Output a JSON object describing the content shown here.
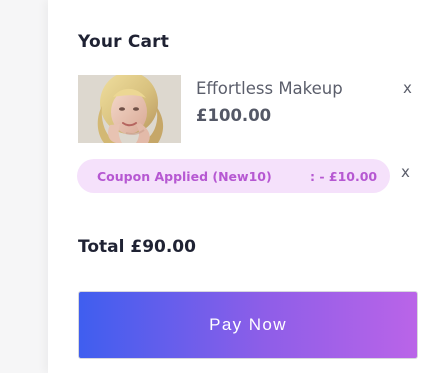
{
  "cart": {
    "title": "Your Cart",
    "item": {
      "name": "Effortless Makeup",
      "price": "£100.00",
      "image_icon": "product-thumbnail",
      "remove_label": "x"
    },
    "coupon": {
      "label": "Coupon Applied (New10)",
      "discount": ": - £10.00",
      "remove_label": "x"
    },
    "total": "Total £90.00",
    "pay_button_label": "Pay Now"
  },
  "colors": {
    "coupon_background": "#f5e1fb",
    "coupon_text": "#b658d2",
    "pay_gradient_start": "#3f5eef",
    "pay_gradient_end": "#ba64e8"
  }
}
